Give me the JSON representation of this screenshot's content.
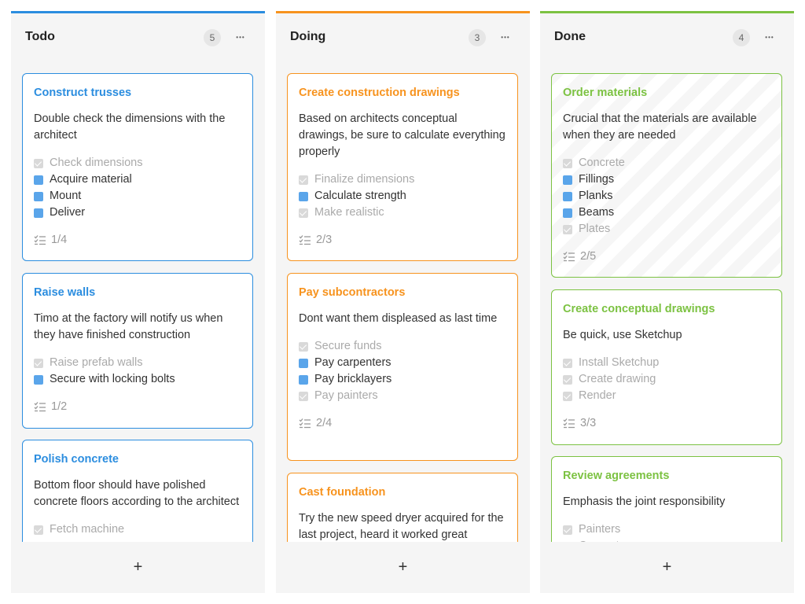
{
  "columns": [
    {
      "title": "Todo",
      "count": "5",
      "menu": "•••",
      "add": "+",
      "accent": "#2b8ddf",
      "cards": [
        {
          "title": "Construct trusses",
          "description": "Double check the dimensions with the architect",
          "checklist": [
            {
              "text": "Check dimensions",
              "done": true
            },
            {
              "text": "Acquire material",
              "done": false
            },
            {
              "text": "Mount",
              "done": false
            },
            {
              "text": "Deliver",
              "done": false
            }
          ],
          "progress": "1/4"
        },
        {
          "title": "Raise walls",
          "description": "Timo at the factory will notify us when they have finished construction",
          "checklist": [
            {
              "text": "Raise prefab walls",
              "done": true
            },
            {
              "text": "Secure with locking bolts",
              "done": false
            }
          ],
          "progress": "1/2"
        },
        {
          "title": "Polish concrete",
          "description": "Bottom floor should have polished concrete floors according to the architect",
          "checklist": [
            {
              "text": "Fetch machine",
              "done": true
            }
          ],
          "progress": ""
        }
      ]
    },
    {
      "title": "Doing",
      "count": "3",
      "menu": "•••",
      "add": "+",
      "accent": "#f7931e",
      "cards": [
        {
          "title": "Create construction drawings",
          "description": "Based on architects conceptual drawings, be sure to calculate everything properly",
          "checklist": [
            {
              "text": "Finalize dimensions",
              "done": true
            },
            {
              "text": "Calculate strength",
              "done": false
            },
            {
              "text": "Make realistic",
              "done": true
            }
          ],
          "progress": "2/3"
        },
        {
          "title": "Pay subcontractors",
          "description": "Dont want them displeased as last time",
          "checklist": [
            {
              "text": "Secure funds",
              "done": true
            },
            {
              "text": "Pay carpenters",
              "done": false
            },
            {
              "text": "Pay bricklayers",
              "done": false
            },
            {
              "text": "Pay painters",
              "done": true
            }
          ],
          "progress": "2/4"
        },
        {
          "title": "Cast foundation",
          "description": "Try the new speed dryer acquired for the last project, heard it worked great",
          "checklist": [],
          "progress": ""
        }
      ]
    },
    {
      "title": "Done",
      "count": "4",
      "menu": "•••",
      "add": "+",
      "accent": "#7cc242",
      "cards": [
        {
          "title": "Order materials",
          "description": "Crucial that the materials are available when they are needed",
          "checklist": [
            {
              "text": "Concrete",
              "done": true
            },
            {
              "text": "Fillings",
              "done": false
            },
            {
              "text": "Planks",
              "done": false
            },
            {
              "text": "Beams",
              "done": false
            },
            {
              "text": "Plates",
              "done": true
            }
          ],
          "progress": "2/5",
          "striped": true
        },
        {
          "title": "Create conceptual drawings",
          "description": "Be quick, use Sketchup",
          "checklist": [
            {
              "text": "Install Sketchup",
              "done": true
            },
            {
              "text": "Create drawing",
              "done": true
            },
            {
              "text": "Render",
              "done": true
            }
          ],
          "progress": "3/3"
        },
        {
          "title": "Review agreements",
          "description": "Emphasis the joint responsibility",
          "checklist": [
            {
              "text": "Painters",
              "done": true
            },
            {
              "text": "Carpenters",
              "done": true
            }
          ],
          "progress": ""
        }
      ]
    }
  ],
  "colors": {
    "todo_check": "#5aa5ea",
    "done_check": "#d9d9d9"
  },
  "icons": {
    "progress": "checklist-icon",
    "menu": "more-horizontal-icon",
    "add": "plus-icon",
    "check": "checkbox-checked-icon"
  }
}
